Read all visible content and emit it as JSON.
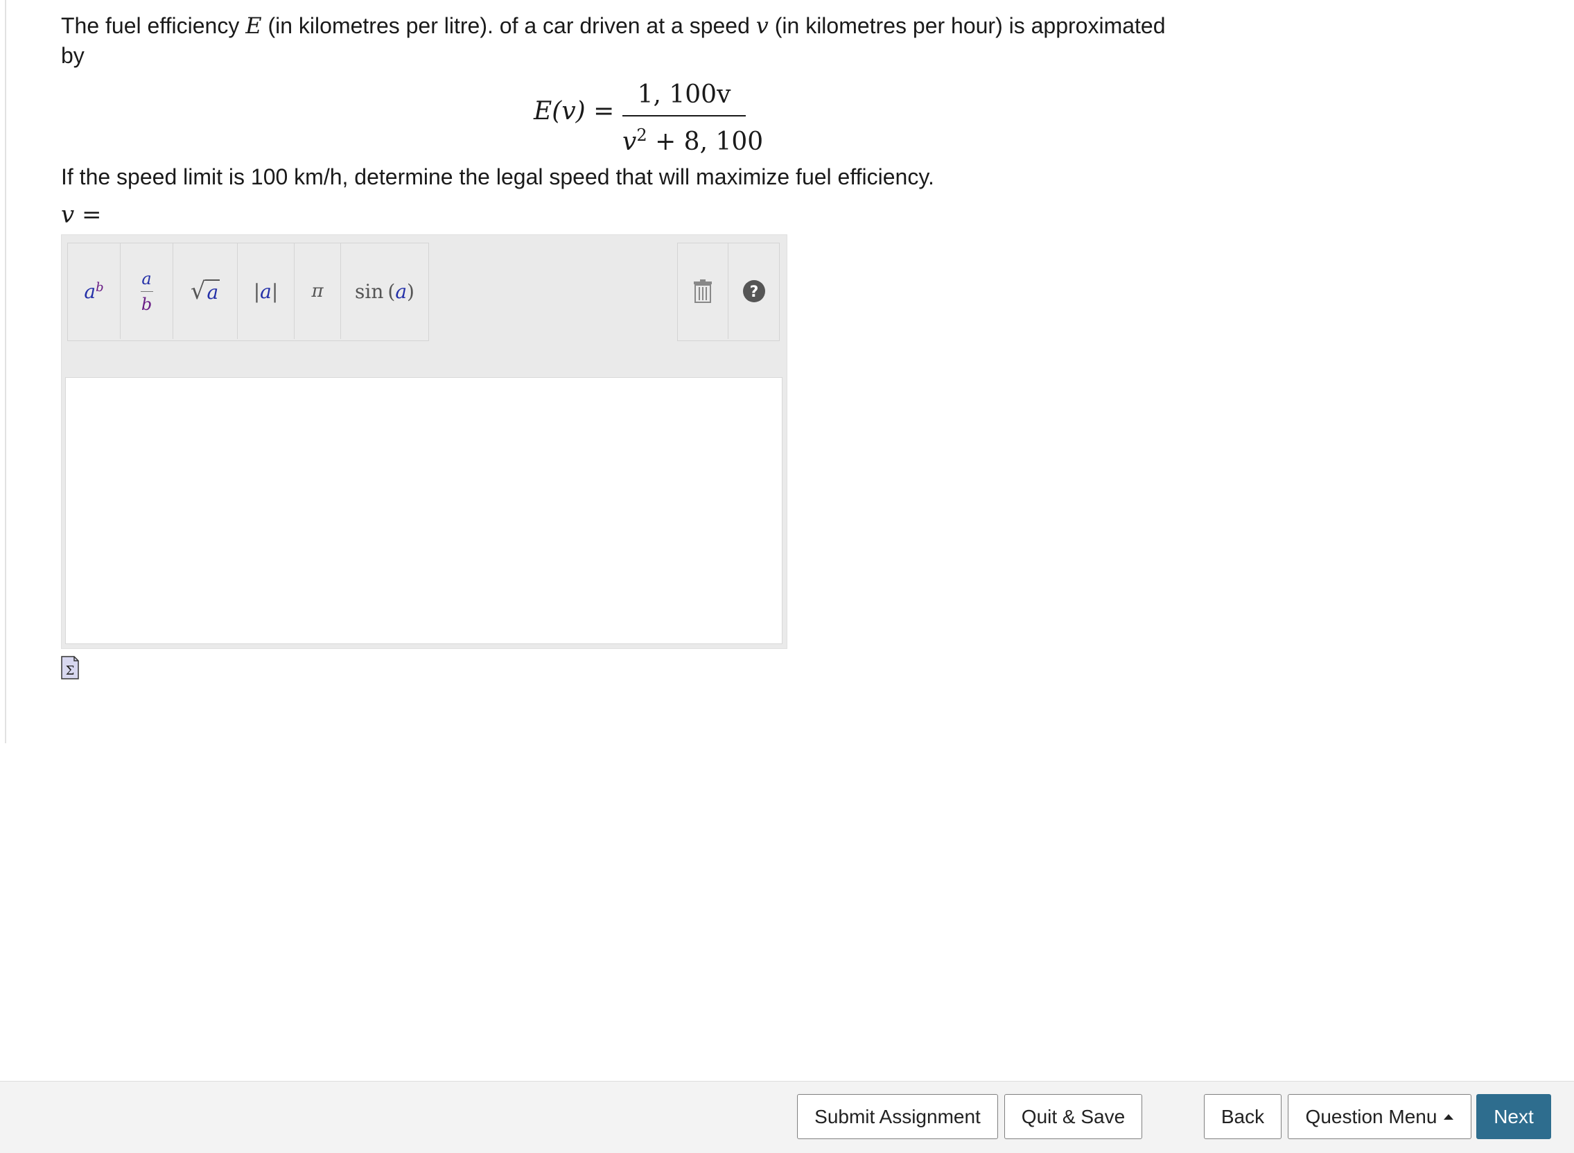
{
  "question": {
    "part1": "The fuel efficiency ",
    "var_E": "E",
    "part2": " (in kilometres per litre). of a car driven at a speed ",
    "var_v": "v",
    "part3": " (in kilometres per hour) is approximated by"
  },
  "formula": {
    "lhs": "E(v) =",
    "numerator": "1, 100v",
    "denominator_base": "v",
    "denominator_exp": "2",
    "denominator_rest": " + 8, 100"
  },
  "prompt": "If the speed limit is 100 km/h, determine the legal speed that will maximize fuel efficiency.",
  "answer": {
    "label": "v =",
    "value": ""
  },
  "toolbar": {
    "power": {
      "base": "a",
      "exp": "b"
    },
    "fraction": {
      "num": "a",
      "den": "b"
    },
    "sqrt": {
      "radical": "√",
      "arg": "a"
    },
    "abs": {
      "bar": "|",
      "arg": "a"
    },
    "pi": "π",
    "sin": {
      "fn": "sin",
      "arg": "a"
    },
    "icons": [
      "trash-icon",
      "help-icon",
      "sigma-icon"
    ]
  },
  "footer": {
    "submit": "Submit Assignment",
    "quit_save": "Quit & Save",
    "back": "Back",
    "question_menu": "Question Menu",
    "next": "Next"
  },
  "colors": {
    "primary_button": "#2e6d8e",
    "toolbar_bg": "#ebebeb",
    "math_blue": "#2430a8",
    "math_purple": "#6a1e86"
  }
}
